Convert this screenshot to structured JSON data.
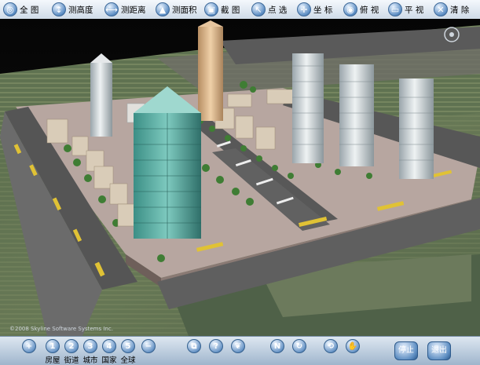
{
  "toolbar": {
    "items": [
      {
        "label": "全  图",
        "icon": "globe-icon"
      },
      {
        "label": "测高度",
        "icon": "measure-height-icon"
      },
      {
        "label": "测距离",
        "icon": "ruler-icon"
      },
      {
        "label": "测面积",
        "icon": "area-icon"
      },
      {
        "label": "截  图",
        "icon": "camera-icon"
      },
      {
        "label": "点  选",
        "icon": "pointer-icon"
      },
      {
        "label": "坐  标",
        "icon": "crosshair-icon"
      },
      {
        "label": "俯  视",
        "icon": "eye-icon"
      },
      {
        "label": "平  视",
        "icon": "level-view-icon"
      },
      {
        "label": "清  除",
        "icon": "eraser-icon"
      }
    ]
  },
  "bottombar": {
    "zoom_in": "+",
    "levels": [
      {
        "num": "1",
        "label": "房屋"
      },
      {
        "num": "2",
        "label": "街道"
      },
      {
        "num": "3",
        "label": "城市"
      },
      {
        "num": "4",
        "label": "国家"
      },
      {
        "num": "5",
        "label": "全球"
      }
    ],
    "zoom_out": "−",
    "nav_icons": [
      "layers-icon",
      "question-icon",
      "leaf-icon",
      "north-icon",
      "rotate-icon",
      "camera-rotate-icon",
      "hand-icon"
    ],
    "stop_label": "停止",
    "exit_label": "退出"
  },
  "copyright": "©2008 Skyline Software Systems Inc."
}
